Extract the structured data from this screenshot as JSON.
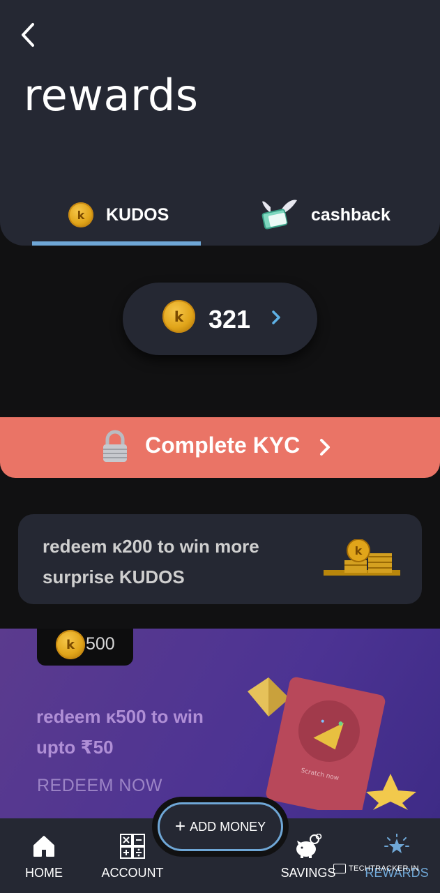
{
  "header": {
    "back_icon": "chevron-left-icon",
    "title": "rewards",
    "tabs": [
      {
        "label": "KUDOS",
        "icon": "kudos-coin-icon",
        "active": true
      },
      {
        "label": "cashback",
        "icon": "winged-cash-icon",
        "active": false
      }
    ]
  },
  "balance": {
    "value": "321",
    "coin_letter": "k",
    "arrow_icon": "chevron-right-icon"
  },
  "kyc": {
    "label": "Complete KYC",
    "icon": "lock-icon",
    "arrow_icon": "chevron-right-icon"
  },
  "redeem_card": {
    "line1": "redeem ᴋ200 to win more",
    "line2": "surprise KUDOS",
    "icon": "coin-stack-icon"
  },
  "promo": {
    "badge_value": "500",
    "line1": "redeem ᴋ500 to win",
    "line2": "upto ₹50",
    "cta": "REDEEM NOW",
    "scratch_label": "Scratch now"
  },
  "add_money": {
    "plus": "+",
    "label": "ADD MONEY"
  },
  "nav": [
    {
      "label": "HOME",
      "icon": "home-icon"
    },
    {
      "label": "ACCOUNT",
      "icon": "calculator-icon"
    },
    {
      "label": "SAVINGS",
      "icon": "piggy-bank-icon"
    },
    {
      "label": "REWARDS",
      "icon": "star-icon"
    }
  ],
  "watermark": "TECHTRACKER.IN",
  "colors": {
    "accent": "#6fa7d6",
    "kyc": "#ea7466",
    "card": "#252833",
    "promo": "#4c3393"
  }
}
